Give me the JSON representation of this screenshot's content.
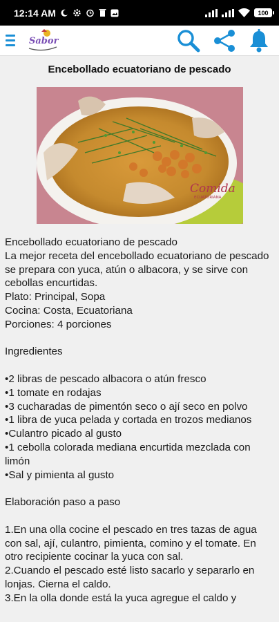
{
  "status_bar": {
    "time": "12:14 AM",
    "battery": "100"
  },
  "app_bar": {
    "logo_text": "Sabor",
    "icons": [
      "menu-icon",
      "search-icon",
      "share-icon",
      "bell-icon"
    ],
    "accent_color": "#1a8fd6"
  },
  "recipe": {
    "title": "Encebollado ecuatoriano de pescado",
    "photo_watermark": "Comida",
    "photo_watermark_sub": "ECUATORIANA",
    "name": "Encebollado ecuatoriano de pescado",
    "description": "La mejor receta del encebollado ecuatoriano de pescado se prepara con yuca, atún o albacora, y se sirve con cebollas encurtidas.",
    "dish": "Plato: Principal, Sopa",
    "cuisine": "Cocina: Costa, Ecuatoriana",
    "servings": "Porciones: 4 porciones",
    "ingredients_heading": "Ingredientes",
    "ingredients": [
      "•2 libras de pescado albacora o atún fresco",
      "•1 tomate en rodajas",
      "•3 cucharadas de pimentón seco o ají seco en polvo",
      "•1 libra de yuca pelada y cortada en trozos medianos",
      "•Culantro picado al gusto",
      "•1 cebolla colorada mediana encurtida mezclada con limón",
      "•Sal y pimienta al gusto"
    ],
    "steps_heading": "Elaboración paso a paso",
    "steps": [
      "1.En una olla cocine el pescado en tres tazas de agua con sal, ají, culantro, pimienta, comino y el tomate. En otro recipiente cocinar la yuca con sal.",
      "2.Cuando el pescado esté listo sacarlo y separarlo en lonjas. Cierna el caldo.",
      "3.En la olla donde está la yuca agregue el caldo y"
    ]
  }
}
